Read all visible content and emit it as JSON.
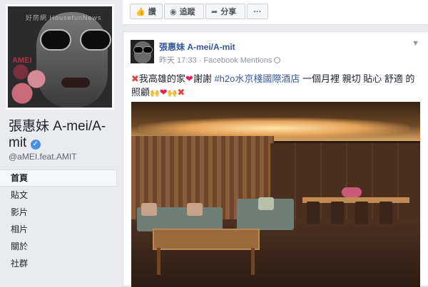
{
  "watermark": "好房網 HousefunNews",
  "page": {
    "name": "張惠妹 A-mei/A-mit",
    "handle": "@aMEI.feat.AMIT",
    "profile_mark": "AMEI"
  },
  "nav": {
    "items": [
      {
        "label": "首頁",
        "active": true
      },
      {
        "label": "貼文",
        "active": false
      },
      {
        "label": "影片",
        "active": false
      },
      {
        "label": "相片",
        "active": false
      },
      {
        "label": "關於",
        "active": false
      },
      {
        "label": "社群",
        "active": false
      }
    ]
  },
  "actions": {
    "like_label": "讚",
    "follow_label": "追蹤",
    "share_label": "分享",
    "more_label": "···"
  },
  "post": {
    "author": "張惠妹 A-mei/A-mit",
    "time": "昨天 17:33",
    "separator": " · ",
    "source": "Facebook Mentions",
    "text_1": "我高雄的家",
    "text_2": "謝謝 ",
    "hashtag": "#h2o水京棧國際酒店",
    "text_3": " 一個月裡 親切 貼心 舒適 的照顧"
  },
  "colors": {
    "link": "#365899",
    "background": "#e9ebee"
  }
}
